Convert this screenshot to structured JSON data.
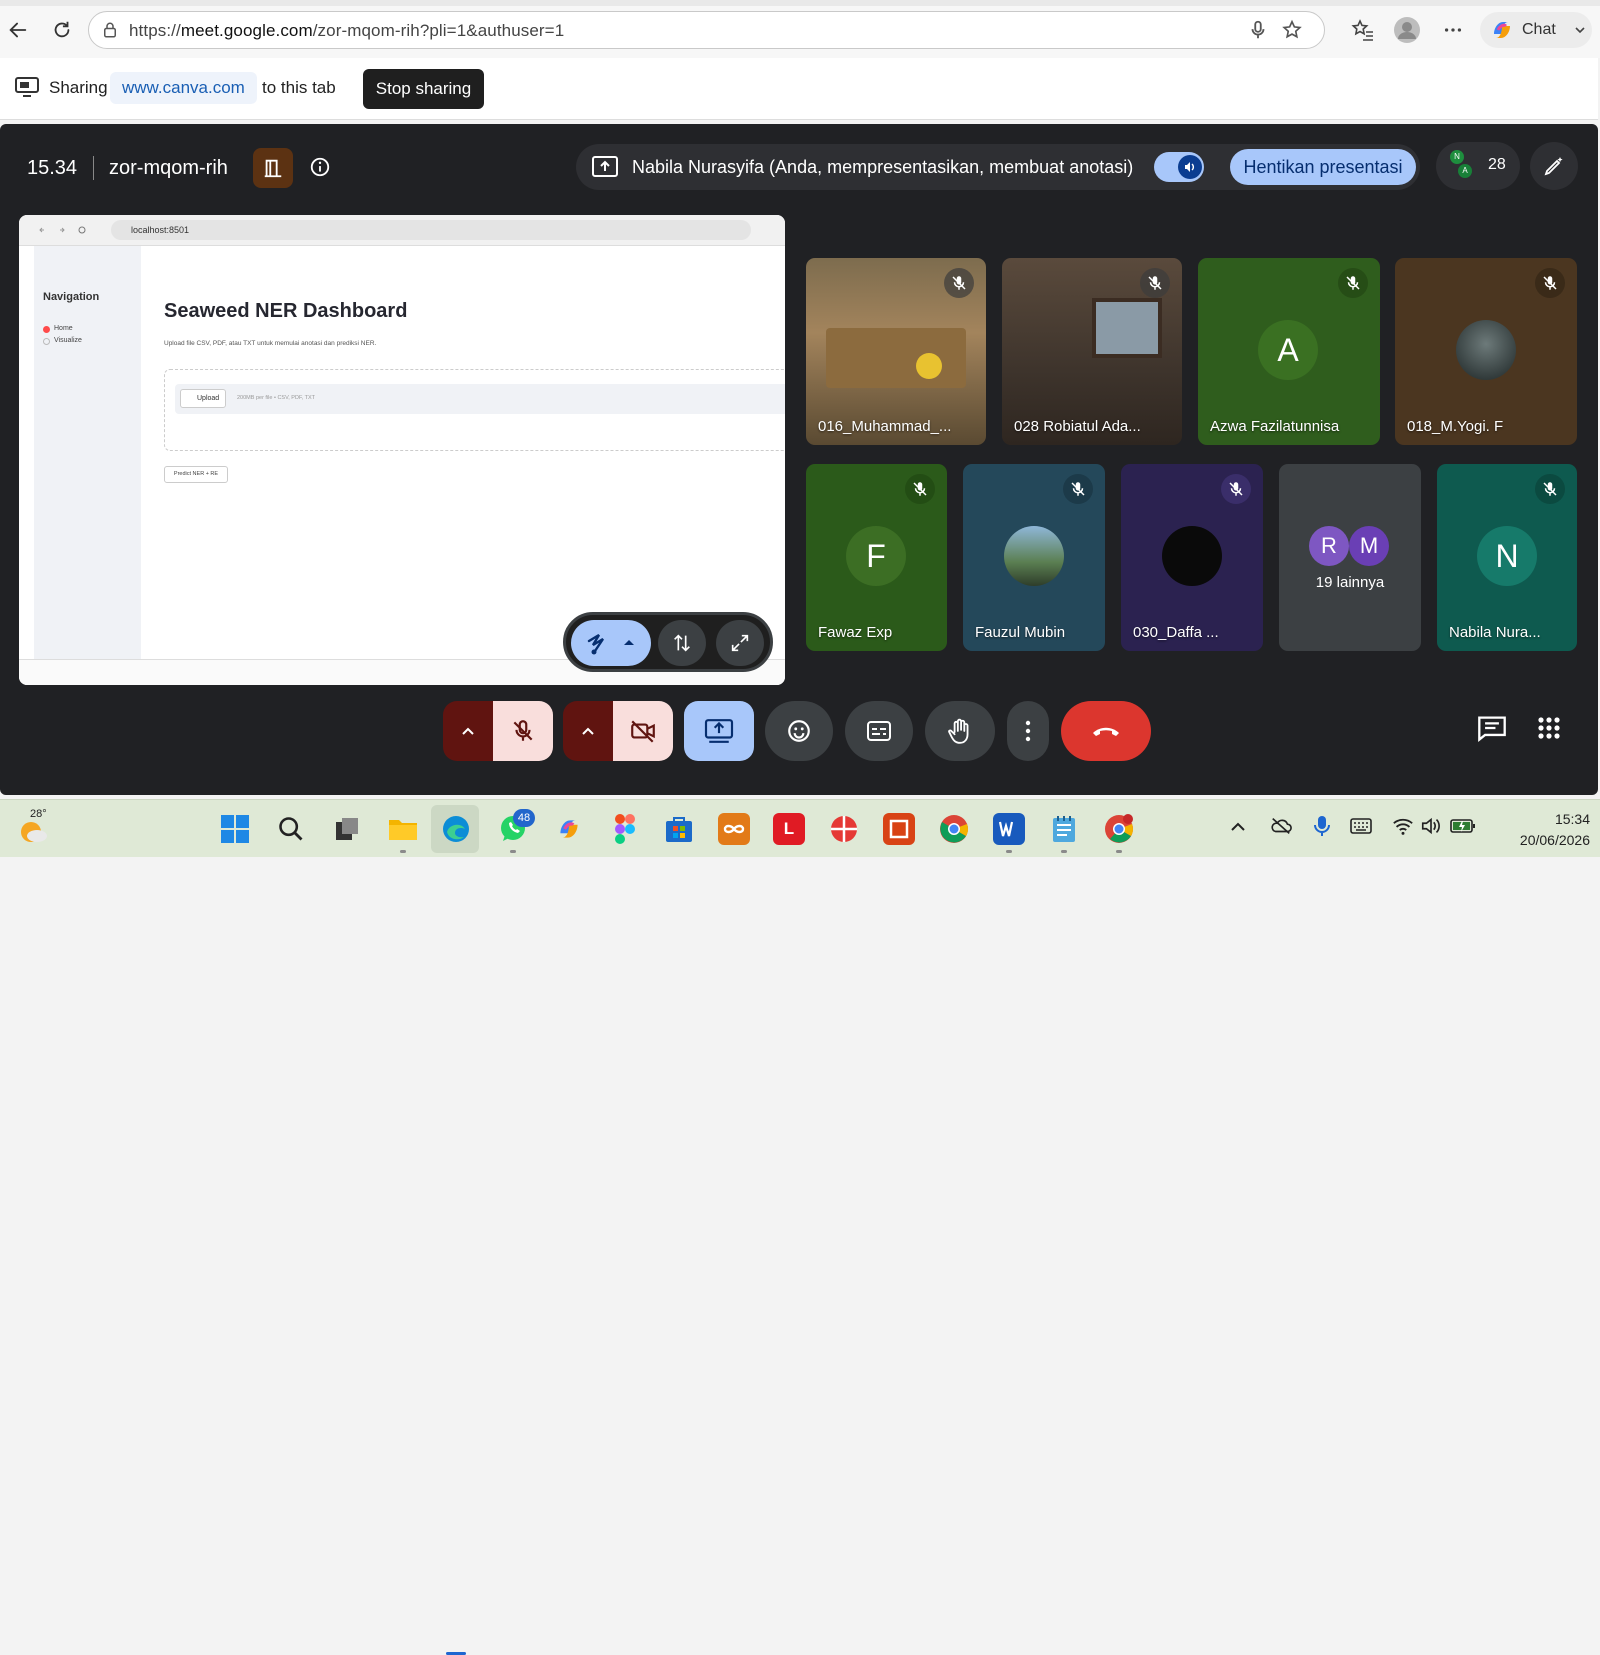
{
  "browser": {
    "url_prefix": "https://",
    "url_host": "meet.google.com",
    "url_path": "/zor-mqom-rih?pli=1&authuser=1",
    "chat_label": "Chat"
  },
  "sharing_bar": {
    "sharing_label": "Sharing",
    "shared_domain": "www.canva.com",
    "to_tab_label": "to this tab",
    "stop_label": "Stop sharing"
  },
  "meet": {
    "time": "15.34",
    "meeting_code": "zor-mqom-rih",
    "presenter_text": "Nabila Nurasyifa (Anda, mempresentasikan, membuat anotasi)",
    "stop_presenting_label": "Hentikan presentasi",
    "participant_count": "28",
    "people_avatars": [
      "N",
      "A"
    ]
  },
  "shared_screen": {
    "url": "localhost:8501",
    "nav_title": "Navigation",
    "nav_items": [
      "Home",
      "Visualize"
    ],
    "title": "Seaweed NER Dashboard",
    "subtitle": "Upload file CSV, PDF, atau TXT untuk memulai anotasi dan prediksi NER.",
    "upload_label": "Upload",
    "upload_hint": "200MB per file • CSV, PDF, TXT",
    "predict_label": "Predict NER + RE"
  },
  "tiles": [
    {
      "name": "016_Muhammad_...",
      "bg": "#6b5a3e"
    },
    {
      "name": "028 Robiatul Ada...",
      "bg": "#4e4238"
    },
    {
      "name": "Azwa Fazilatunnisa",
      "initial": "A",
      "bg": "#2f5d1d",
      "avatar_bg": "#3a7022"
    },
    {
      "name": "018_M.Yogi. F",
      "bg": "#4b3620"
    },
    {
      "name": "Fawaz Exp",
      "initial": "F",
      "bg": "#2b5a1a",
      "avatar_bg": "#3c6e24"
    },
    {
      "name": "Fauzul Mubin",
      "bg": "#24485a"
    },
    {
      "name": "030_Daffa ...",
      "bg": "#2b2250"
    },
    {
      "name": "19 lainnya",
      "initials": [
        "R",
        "M"
      ],
      "bg": "#3c4043"
    },
    {
      "name": "Nabila Nura...",
      "initial": "N",
      "bg": "#0e5a4f",
      "avatar_bg": "#167a6a"
    }
  ],
  "taskbar": {
    "temperature": "28°",
    "whatsapp_badge": "48",
    "time": "15:34",
    "date": "20/06/2026",
    "apps": [
      "L"
    ]
  }
}
